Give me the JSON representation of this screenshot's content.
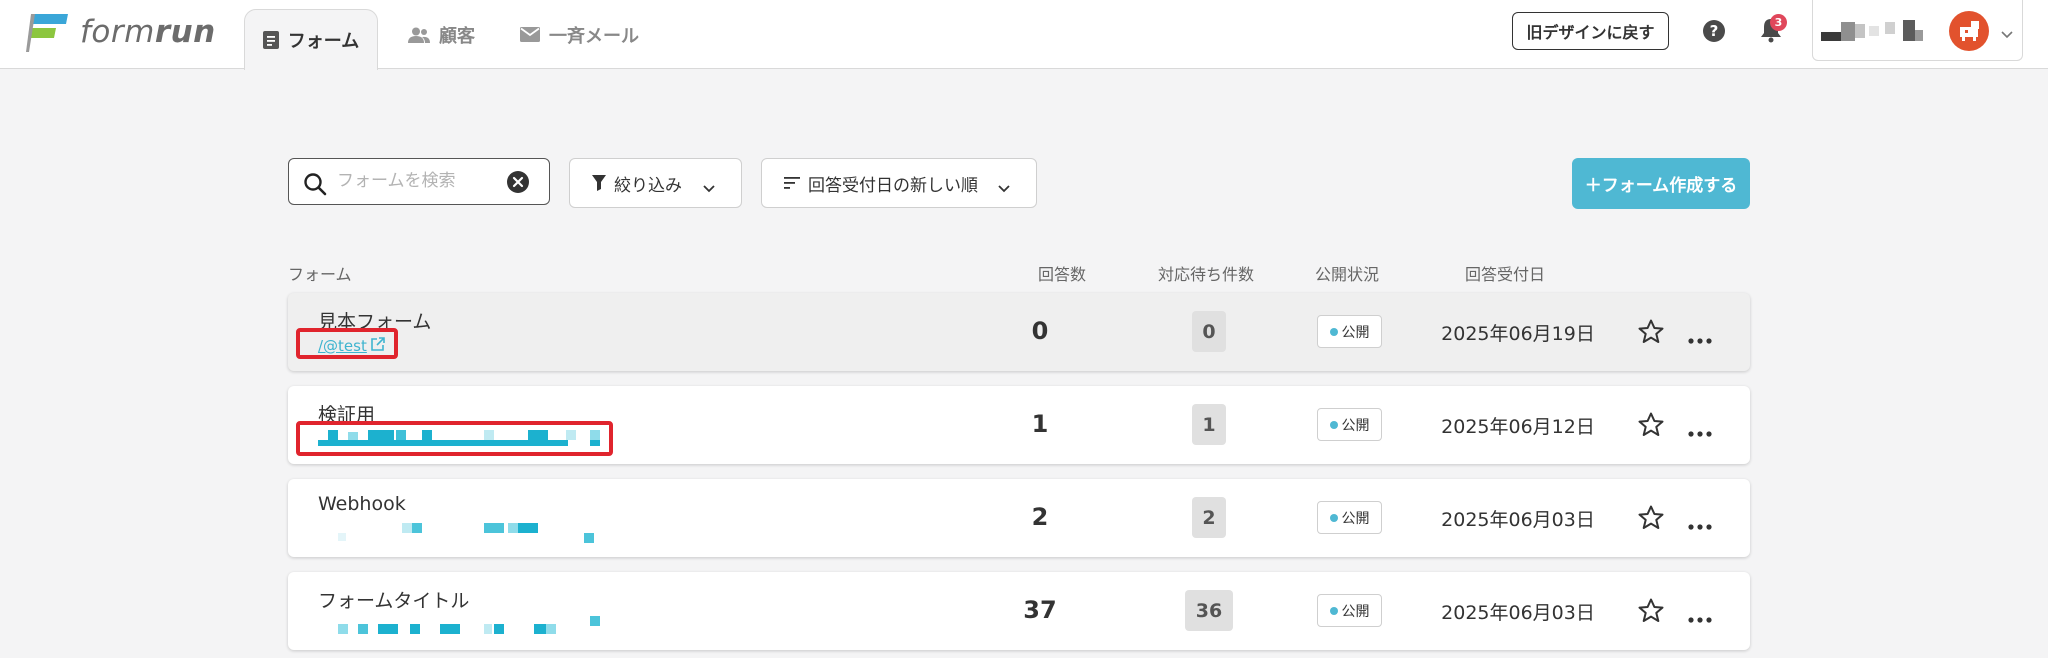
{
  "brand": {
    "logo_text_light": "form",
    "logo_text_bold": "run",
    "colors": {
      "green": "#8cc63f",
      "blue": "#3aa6d8",
      "accent": "#4fb8d3",
      "badge": "#e0475b"
    }
  },
  "nav": {
    "tabs": [
      {
        "label": "フォーム",
        "icon": "form-doc-icon",
        "active": true
      },
      {
        "label": "顧客",
        "icon": "customers-icon",
        "active": false
      },
      {
        "label": "一斉メール",
        "icon": "mail-icon",
        "active": false
      }
    ]
  },
  "header": {
    "old_design_label": "旧デザインに戻す",
    "help_icon": "question-circle-icon",
    "notification_count": "3"
  },
  "toolbar": {
    "search_placeholder": "フォームを検索",
    "search_value": "",
    "filter_label": "絞り込み",
    "sort_label": "回答受付日の新しい順",
    "create_label": "＋フォーム作成する"
  },
  "table": {
    "columns": [
      "フォーム",
      "回答数",
      "対応待ち件数",
      "公開状況",
      "回答受付日"
    ],
    "rows": [
      {
        "title": "見本フォーム",
        "link": "/@test",
        "count": "0",
        "pending": "0",
        "status": "公開",
        "date": "2025年06月19日"
      },
      {
        "title": "検証用",
        "link": "",
        "count": "1",
        "pending": "1",
        "status": "公開",
        "date": "2025年06月12日"
      },
      {
        "title": "Webhook",
        "link": "",
        "count": "2",
        "pending": "2",
        "status": "公開",
        "date": "2025年06月03日"
      },
      {
        "title": "フォームタイトル",
        "link": "",
        "count": "37",
        "pending": "36",
        "status": "公開",
        "date": "2025年06月03日"
      }
    ]
  }
}
